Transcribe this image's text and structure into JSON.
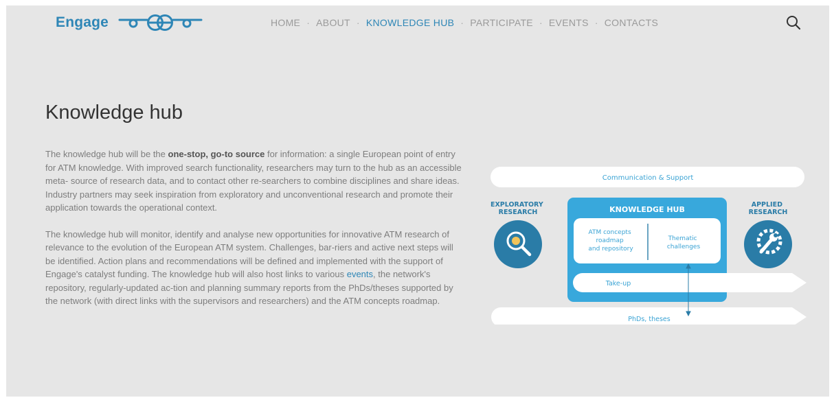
{
  "header": {
    "logo_text": "Engage",
    "nav": [
      {
        "label": "HOME"
      },
      {
        "label": "ABOUT"
      },
      {
        "label": "KNOWLEDGE HUB",
        "active": true
      },
      {
        "label": "PARTICIPATE"
      },
      {
        "label": "EVENTS"
      },
      {
        "label": "CONTACTS"
      }
    ],
    "nav_separator": "·",
    "search_icon": "search-icon"
  },
  "main": {
    "title": "Knowledge hub",
    "p1": {
      "before": "The knowledge hub will be the ",
      "bold": "one-stop, go-to source",
      "after": " for information: a single European point of entry for ATM knowledge. With improved search functionality, researchers may turn to the hub as an accessible meta- source of research data, and to contact other re-searchers to combine disciplines and share ideas. Industry partners may seek inspiration from exploratory and unconventional research and promote their application towards the operational context."
    },
    "p2": {
      "before": "The knowledge hub will monitor, identify and analyse new opportunities for innovative ATM research of relevance to the evolution of the European ATM system. Challenges, bar-riers and active next steps will be identified. Action plans and recommendations will be defined and implemented with the support of Engage's catalyst funding. The knowledge hub will also host links to various ",
      "link": "events",
      "after": ", the network's repository, regularly-updated ac-tion and planning summary reports from the PhDs/theses supported by the network (with direct links with the supervisors and researchers) and the ATM concepts roadmap."
    }
  },
  "diagram": {
    "communication": "Communication & Support",
    "exploratory": [
      "EXPLORATORY",
      "RESEARCH"
    ],
    "applied": [
      "APPLIED",
      "RESEARCH"
    ],
    "hub_title": "KNOWLEDGE HUB",
    "atm": [
      "ATM concepts",
      "roadmap",
      "and repository"
    ],
    "thematic": [
      "Thematic",
      "challenges"
    ],
    "takeup": "Take-up",
    "phds": "PhDs, theses",
    "colors": {
      "brand": "#2e86b6",
      "hub": "#38a8dc",
      "icon": "#2a7ca7",
      "text": "#3aa3d4"
    }
  }
}
